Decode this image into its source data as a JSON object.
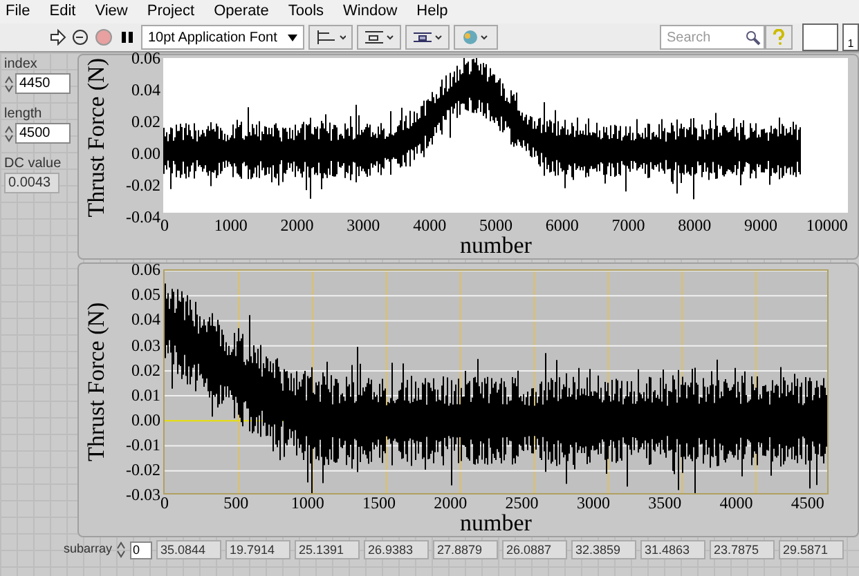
{
  "menu": [
    "File",
    "Edit",
    "View",
    "Project",
    "Operate",
    "Tools",
    "Window",
    "Help"
  ],
  "toolbar": {
    "font": "10pt Application Font",
    "search": {
      "placeholder": "Search"
    },
    "connector_number": "1"
  },
  "controls": [
    {
      "label": "index",
      "value": "4450",
      "kind": "numeric"
    },
    {
      "label": "length",
      "value": "4500",
      "kind": "numeric"
    },
    {
      "label": "DC value",
      "value": "0.0043",
      "kind": "indicator"
    }
  ],
  "charts": [
    {
      "kind": "full",
      "ylabel": "Thrust  Force  (N)",
      "yticks": [
        "0.06",
        "0.04",
        "0.02",
        "0.00",
        "-0.02",
        "-0.04"
      ],
      "xticks": [
        "0",
        "1000",
        "2000",
        "3000",
        "4000",
        "5000",
        "6000",
        "7000",
        "8000",
        "9000",
        "10000"
      ],
      "xlabel": "number"
    },
    {
      "kind": "zoom",
      "ylabel": "Thrust  Force  (N)",
      "yticks": [
        "0.06",
        "0.05",
        "0.04",
        "0.03",
        "0.02",
        "0.01",
        "0.00",
        "-0.01",
        "-0.02",
        "-0.03"
      ],
      "xticks": [
        "0",
        "500",
        "1000",
        "1500",
        "2000",
        "2500",
        "3000",
        "3500",
        "4000",
        "4500"
      ],
      "xlabel": "number"
    }
  ],
  "subarray": {
    "label": "subarray",
    "index": "0",
    "values": [
      "35.0844",
      "19.7914",
      "25.1391",
      "26.9383",
      "27.8879",
      "26.0887",
      "32.3859",
      "31.4863",
      "23.7875",
      "29.5871"
    ]
  }
}
